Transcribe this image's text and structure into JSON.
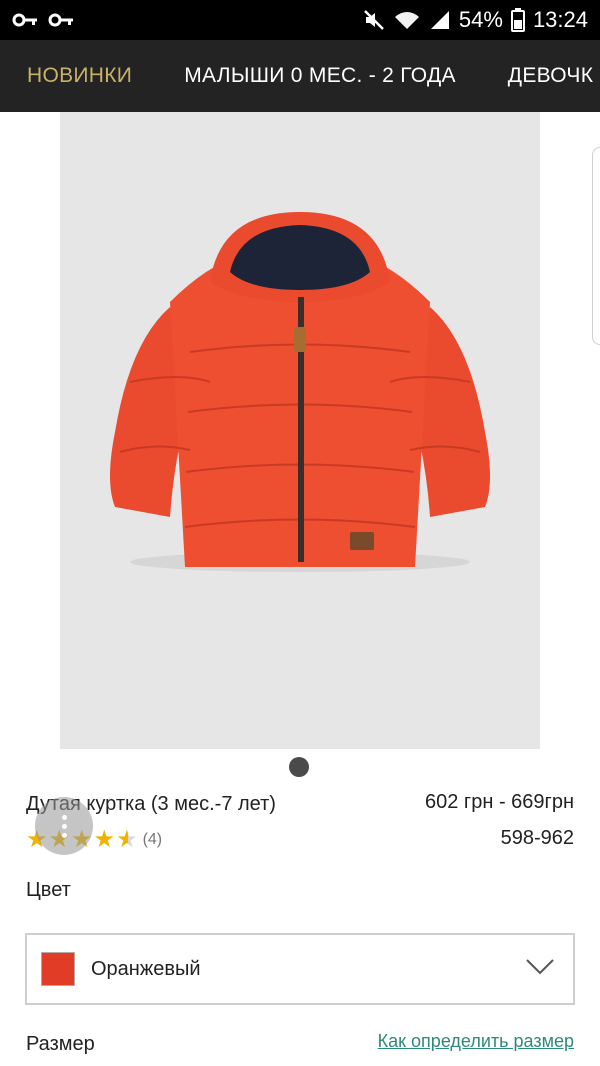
{
  "status_bar": {
    "battery_percent": "54%",
    "time": "13:24",
    "icons": [
      "key-icon",
      "key-icon",
      "mute-icon",
      "wifi-icon",
      "signal-icon",
      "battery-icon"
    ]
  },
  "nav": {
    "tabs": [
      {
        "label": "НОВИНКИ",
        "active": true
      },
      {
        "label": "МАЛЫШИ 0 МЕС. - 2 ГОДА",
        "active": false
      },
      {
        "label": "ДЕВОЧК",
        "active": false
      }
    ]
  },
  "product": {
    "image": "orange-puffer-jacket",
    "title": "Дутая куртка (3 мес.-7 лет)",
    "price": "602 грн - 669грн",
    "code": "598-962",
    "rating": 4.5,
    "rating_count": "(4)"
  },
  "color": {
    "label": "Цвет",
    "value": "Оранжевый",
    "swatch": "#e03c26"
  },
  "size": {
    "label": "Размер",
    "guide_link": "Как определить размер"
  }
}
